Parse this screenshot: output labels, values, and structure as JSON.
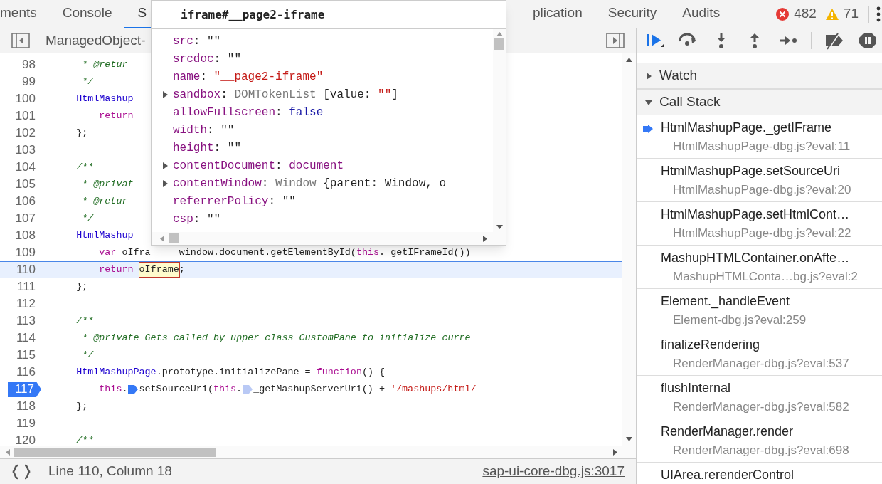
{
  "tabs": [
    {
      "label": "ments",
      "selected": false
    },
    {
      "label": "Console",
      "selected": false
    },
    {
      "label": "S",
      "selected": true
    },
    {
      "label": "plication",
      "selected": false
    },
    {
      "label": "Security",
      "selected": false
    },
    {
      "label": "Audits",
      "selected": false
    }
  ],
  "counters": {
    "errors": "482",
    "warnings": "71"
  },
  "editor": {
    "file_tab": "ManagedObject-",
    "lines": [
      {
        "number": "98",
        "current": false,
        "breakpoint": false,
        "tokens": [
          {
            "kind": "comment",
            "text": "     * @retur"
          }
        ]
      },
      {
        "number": "99",
        "current": false,
        "breakpoint": false,
        "tokens": [
          {
            "kind": "comment",
            "text": "     */"
          }
        ]
      },
      {
        "number": "100",
        "current": false,
        "breakpoint": false,
        "tokens": [
          {
            "kind": "class",
            "text": "    HtmlMashup"
          }
        ]
      },
      {
        "number": "101",
        "current": false,
        "breakpoint": false,
        "tokens": [
          {
            "kind": "keyword",
            "text": "        return"
          }
        ]
      },
      {
        "number": "102",
        "current": false,
        "breakpoint": false,
        "tokens": [
          {
            "kind": "plain",
            "text": "    };"
          }
        ]
      },
      {
        "number": "103",
        "current": false,
        "breakpoint": false
      },
      {
        "number": "104",
        "current": false,
        "breakpoint": false,
        "tokens": [
          {
            "kind": "comment",
            "text": "    /**"
          }
        ]
      },
      {
        "number": "105",
        "current": false,
        "breakpoint": false,
        "tokens": [
          {
            "kind": "comment",
            "text": "     * @privat"
          }
        ]
      },
      {
        "number": "106",
        "current": false,
        "breakpoint": false,
        "tokens": [
          {
            "kind": "comment",
            "text": "     * @retur"
          }
        ]
      },
      {
        "number": "107",
        "current": false,
        "breakpoint": false,
        "tokens": [
          {
            "kind": "comment",
            "text": "     */"
          }
        ]
      },
      {
        "number": "108",
        "current": false,
        "breakpoint": false,
        "tokens": [
          {
            "kind": "class",
            "text": "    HtmlMashup"
          }
        ]
      },
      {
        "number": "109",
        "current": false,
        "breakpoint": false,
        "tokens": [
          {
            "kind": "keyword",
            "text": "        var"
          },
          {
            "kind": "plain",
            "text": " oIfra"
          },
          {
            "kind": "plain",
            "text": "   = window.document.getElementById("
          },
          {
            "kind": "keyword",
            "text": "this"
          },
          {
            "kind": "plain",
            "text": "._getIFrameId())"
          }
        ]
      },
      {
        "number": "110",
        "current": true,
        "breakpoint": false,
        "tokens": [
          {
            "kind": "keyword",
            "text": "        return "
          },
          {
            "kind": "hovered",
            "text": "oIframe"
          },
          {
            "kind": "plain",
            "text": ";"
          }
        ]
      },
      {
        "number": "111",
        "current": false,
        "breakpoint": false,
        "tokens": [
          {
            "kind": "plain",
            "text": "    };"
          }
        ]
      },
      {
        "number": "112",
        "current": false,
        "breakpoint": false
      },
      {
        "number": "113",
        "current": false,
        "breakpoint": false,
        "tokens": [
          {
            "kind": "comment",
            "text": "    /**"
          }
        ]
      },
      {
        "number": "114",
        "current": false,
        "breakpoint": false,
        "tokens": [
          {
            "kind": "comment",
            "text": "     * @private Gets called by upper class CustomPane to initialize curre"
          }
        ]
      },
      {
        "number": "115",
        "current": false,
        "breakpoint": false,
        "tokens": [
          {
            "kind": "comment",
            "text": "     */"
          }
        ]
      },
      {
        "number": "116",
        "current": false,
        "breakpoint": false,
        "tokens": [
          {
            "kind": "class",
            "text": "    HtmlMashupPage"
          },
          {
            "kind": "plain",
            "text": ".prototype.initializePane = "
          },
          {
            "kind": "keyword",
            "text": "function"
          },
          {
            "kind": "plain",
            "text": "() {"
          }
        ]
      },
      {
        "number": "117",
        "current": false,
        "breakpoint": true,
        "tokens": [
          {
            "kind": "keyword",
            "text": "        this"
          },
          {
            "kind": "plain",
            "text": "."
          },
          {
            "kind": "step",
            "active": true
          },
          {
            "kind": "plain",
            "text": "setSourceUri("
          },
          {
            "kind": "keyword",
            "text": "this"
          },
          {
            "kind": "plain",
            "text": "."
          },
          {
            "kind": "step",
            "active": false
          },
          {
            "kind": "plain",
            "text": "_getMashupServerUri() + "
          },
          {
            "kind": "string",
            "text": "'/mashups/html/"
          }
        ]
      },
      {
        "number": "118",
        "current": false,
        "breakpoint": false,
        "tokens": [
          {
            "kind": "plain",
            "text": "    };"
          }
        ]
      },
      {
        "number": "119",
        "current": false,
        "breakpoint": false
      },
      {
        "number": "120",
        "current": false,
        "breakpoint": false,
        "tokens": [
          {
            "kind": "comment",
            "text": "    /**"
          }
        ]
      }
    ]
  },
  "popover": {
    "title": "iframe#__page2-iframe",
    "properties": [
      {
        "key": "src",
        "expandable": false,
        "value": [
          {
            "kind": "plain",
            "text": ": \"\""
          }
        ]
      },
      {
        "key": "srcdoc",
        "expandable": false,
        "value": [
          {
            "kind": "plain",
            "text": ": \"\""
          }
        ]
      },
      {
        "key": "name",
        "expandable": false,
        "value": [
          {
            "kind": "plain",
            "text": ": "
          },
          {
            "kind": "string",
            "text": "\"__page2-iframe\""
          }
        ]
      },
      {
        "key": "sandbox",
        "expandable": true,
        "value": [
          {
            "kind": "plain",
            "text": ": "
          },
          {
            "kind": "object",
            "text": "DOMTokenList "
          },
          {
            "kind": "plain",
            "text": "[value: "
          },
          {
            "kind": "string",
            "text": "\"\""
          },
          {
            "kind": "plain",
            "text": "]"
          }
        ]
      },
      {
        "key": "allowFullscreen",
        "expandable": false,
        "value": [
          {
            "kind": "plain",
            "text": ": "
          },
          {
            "kind": "keyword",
            "text": "false"
          }
        ]
      },
      {
        "key": "width",
        "expandable": false,
        "value": [
          {
            "kind": "plain",
            "text": ": \"\""
          }
        ]
      },
      {
        "key": "height",
        "expandable": false,
        "value": [
          {
            "kind": "plain",
            "text": ": \"\""
          }
        ]
      },
      {
        "key": "contentDocument",
        "expandable": true,
        "value": [
          {
            "kind": "plain",
            "text": ": "
          },
          {
            "kind": "node",
            "text": "document"
          }
        ]
      },
      {
        "key": "contentWindow",
        "expandable": true,
        "value": [
          {
            "kind": "plain",
            "text": ": "
          },
          {
            "kind": "object",
            "text": "Window "
          },
          {
            "kind": "plain",
            "text": "{parent: Window, o"
          }
        ]
      },
      {
        "key": "referrerPolicy",
        "expandable": false,
        "value": [
          {
            "kind": "plain",
            "text": ": \"\""
          }
        ]
      },
      {
        "key": "csp",
        "expandable": false,
        "value": [
          {
            "kind": "plain",
            "text": ": \"\""
          }
        ]
      }
    ]
  },
  "status_bar": {
    "position": "Line 110, Column 18",
    "source_link": "sap-ui-core-dbg.js:3017"
  },
  "sidebar": {
    "sections": [
      {
        "title": "Watch",
        "expanded": false
      },
      {
        "title": "Call Stack",
        "expanded": true
      }
    ],
    "call_stack": [
      {
        "function": "HtmlMashupPage._getIFrame",
        "location": "HtmlMashupPage-dbg.js?eval:11",
        "selected": true
      },
      {
        "function": "HtmlMashupPage.setSourceUri",
        "location": "HtmlMashupPage-dbg.js?eval:20",
        "selected": false
      },
      {
        "function": "HtmlMashupPage.setHtmlCont…",
        "location": "HtmlMashupPage-dbg.js?eval:22",
        "selected": false
      },
      {
        "function": "MashupHTMLContainer.onAfte…",
        "location": "MashupHTMLConta…bg.js?eval:2",
        "selected": false
      },
      {
        "function": "Element._handleEvent",
        "location": "Element-dbg.js?eval:259",
        "selected": false
      },
      {
        "function": "finalizeRendering",
        "location": "RenderManager-dbg.js?eval:537",
        "selected": false
      },
      {
        "function": "flushInternal",
        "location": "RenderManager-dbg.js?eval:582",
        "selected": false
      },
      {
        "function": "RenderManager.render",
        "location": "RenderManager-dbg.js?eval:698",
        "selected": false
      },
      {
        "function": "UIArea.rerenderControl",
        "selected": false
      }
    ]
  }
}
